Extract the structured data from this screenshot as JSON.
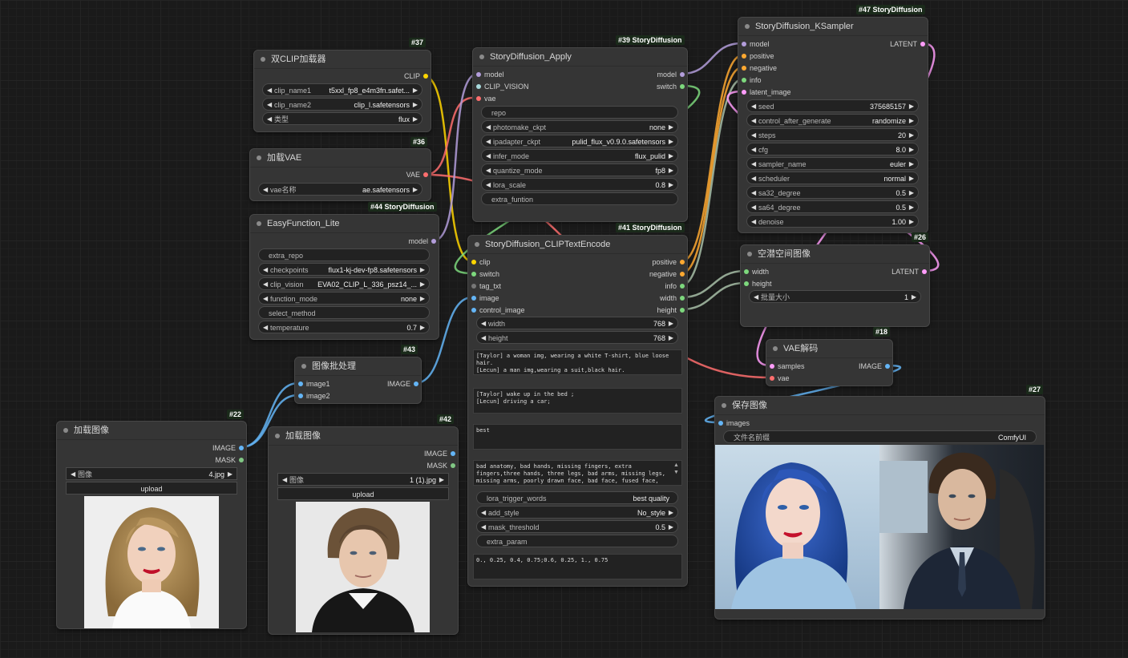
{
  "colors": {
    "clip": "#ffd500",
    "model": "#b39ddb",
    "vae": "#ff6e6e",
    "latent": "#ff9cf9",
    "conditioning": "#ffa931",
    "int": "#7dd87d",
    "image": "#64b5f6",
    "mask": "#81c784",
    "clip_vision": "#a8dadc",
    "gray": "#a8c0a8"
  },
  "nodes": {
    "dualclip": {
      "badge": "#37",
      "title": "双CLIP加载器",
      "out_clip": "CLIP",
      "w1_label": "clip_name1",
      "w1_value": "t5xxl_fp8_e4m3fn.safet...",
      "w2_label": "clip_name2",
      "w2_value": "clip_l.safetensors",
      "w3_label": "类型",
      "w3_value": "flux"
    },
    "vaeload": {
      "badge": "#36",
      "title": "加载VAE",
      "out_vae": "VAE",
      "w1_label": "vae名称",
      "w1_value": "ae.safetensors"
    },
    "easyfunc": {
      "badge": "#44 StoryDiffusion",
      "title": "EasyFunction_Lite",
      "out_model": "model",
      "extra_repo": "extra_repo",
      "w1_label": "checkpoints",
      "w1_value": "flux1-kj-dev-fp8.safetensors",
      "w2_label": "clip_vision",
      "w2_value": "EVA02_CLIP_L_336_psz14_...",
      "w3_label": "function_mode",
      "w3_value": "none",
      "select_method": "select_method",
      "w4_label": "temperature",
      "w4_value": "0.7"
    },
    "apply": {
      "badge": "#39 StoryDiffusion",
      "title": "StoryDiffusion_Apply",
      "in_model": "model",
      "in_clipvision": "CLIP_VISION",
      "in_vae": "vae",
      "out_model": "model",
      "out_switch": "switch",
      "repo": "repo",
      "w1_label": "photomake_ckpt",
      "w1_value": "none",
      "w2_label": "ipadapter_ckpt",
      "w2_value": "pulid_flux_v0.9.0.safetensors",
      "w3_label": "infer_mode",
      "w3_value": "flux_pulid",
      "w4_label": "quantize_mode",
      "w4_value": "fp8",
      "w5_label": "lora_scale",
      "w5_value": "0.8",
      "extra": "extra_funtion"
    },
    "ksampler": {
      "badge": "#47 StoryDiffusion",
      "title": "StoryDiffusion_KSampler",
      "in_model": "model",
      "in_positive": "positive",
      "in_negative": "negative",
      "in_info": "info",
      "in_latent": "latent_image",
      "out_latent": "LATENT",
      "widgets": [
        {
          "label": "seed",
          "value": "375685157"
        },
        {
          "label": "control_after_generate",
          "value": "randomize"
        },
        {
          "label": "steps",
          "value": "20"
        },
        {
          "label": "cfg",
          "value": "8.0"
        },
        {
          "label": "sampler_name",
          "value": "euler"
        },
        {
          "label": "scheduler",
          "value": "normal"
        },
        {
          "label": "sa32_degree",
          "value": "0.5"
        },
        {
          "label": "sa64_degree",
          "value": "0.5"
        },
        {
          "label": "denoise",
          "value": "1.00"
        }
      ]
    },
    "cliptext": {
      "badge": "#41 StoryDiffusion",
      "title": "StoryDiffusion_CLIPTextEncode",
      "in_clip": "clip",
      "in_switch": "switch",
      "in_tag": "tag_txt",
      "in_image": "image",
      "in_control": "control_image",
      "out_positive": "positive",
      "out_negative": "negative",
      "out_info": "info",
      "out_width": "width",
      "out_height": "height",
      "w_width_label": "width",
      "w_width_value": "768",
      "w_height_label": "height",
      "w_height_value": "768",
      "text1": "[Taylor] a woman img, wearing a white T-shirt, blue loose hair.\n[Lecun] a man img,wearing a suit,black hair.",
      "text2": "[Taylor] wake up in the bed ;\n[Lecun] driving a car;",
      "text3": "best",
      "text4": "bad anatomy, bad hands, missing fingers, extra fingers,three hands, three legs, bad arms, missing legs, missing arms, poorly drawn face, bad face, fused face, cloned face, three crus, fused feet, fused thigh, extra crus, ugly fingers, horn,amputation",
      "lora_label": "lora_trigger_words",
      "lora_value": "best quality",
      "style_label": "add_style",
      "style_value": "No_style",
      "mask_label": "mask_threshold",
      "mask_value": "0.5",
      "extra_param": "extra_param",
      "text5": "0., 0.25, 0.4, 0.75;0.6, 0.25, 1., 0.75"
    },
    "latent": {
      "badge": "#26",
      "title": "空潜空间图像",
      "in_width": "width",
      "in_height": "height",
      "out_latent": "LATENT",
      "w1_label": "批量大小",
      "w1_value": "1"
    },
    "vaedecode": {
      "badge": "#18",
      "title": "VAE解码",
      "in_samples": "samples",
      "in_vae": "vae",
      "out_image": "IMAGE"
    },
    "batch": {
      "badge": "#43",
      "title": "图像批处理",
      "in_image1": "image1",
      "in_image2": "image2",
      "out_image": "IMAGE"
    },
    "loadimg1": {
      "badge": "#22",
      "title": "加载图像",
      "out_image": "IMAGE",
      "out_mask": "MASK",
      "w1_label": "图像",
      "w1_value": "4.jpg",
      "upload": "upload"
    },
    "loadimg2": {
      "badge": "#42",
      "title": "加载图像",
      "out_image": "IMAGE",
      "out_mask": "MASK",
      "w1_label": "图像",
      "w1_value": "1 (1).jpg",
      "upload": "upload"
    },
    "save": {
      "badge": "#27",
      "title": "保存图像",
      "in_images": "images",
      "w1_label": "文件名前缀",
      "w1_value": "ComfyUI"
    }
  }
}
